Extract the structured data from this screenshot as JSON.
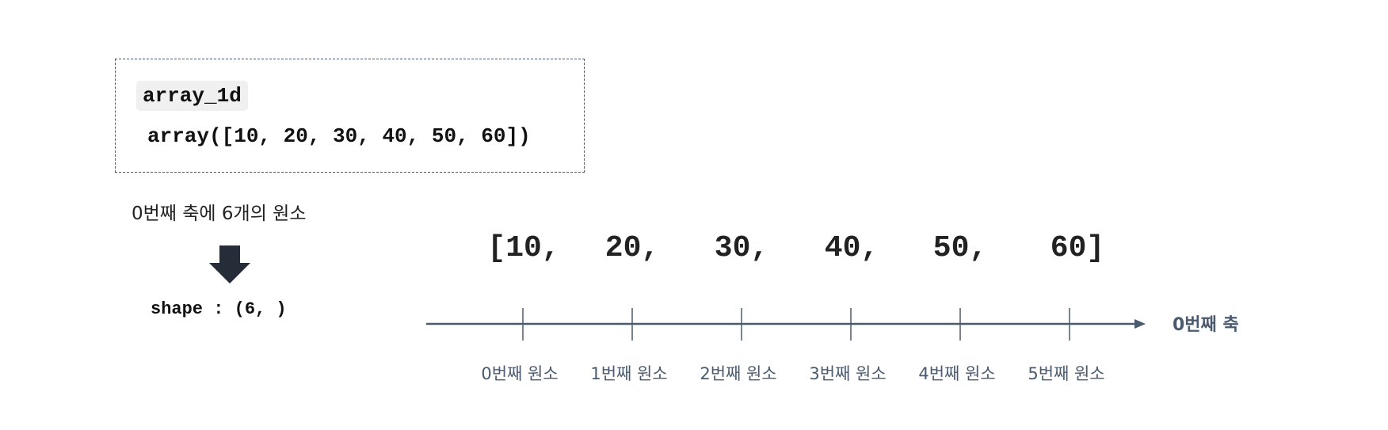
{
  "code_block": {
    "variable": "array_1d",
    "output": "array([10, 20, 30, 40, 50, 60])"
  },
  "caption": "0번째 축에 6개의 원소",
  "shape": "shape : (6, )",
  "array_values": [
    {
      "text": "[10,"
    },
    {
      "text": "20,"
    },
    {
      "text": "30,"
    },
    {
      "text": "40,"
    },
    {
      "text": "50,"
    },
    {
      "text": "60]"
    }
  ],
  "axis": {
    "label": "0번째 축",
    "ticks": [
      {
        "label": "0번째 원소"
      },
      {
        "label": "1번째 원소"
      },
      {
        "label": "2번째 원소"
      },
      {
        "label": "3번째 원소"
      },
      {
        "label": "4번째 원소"
      },
      {
        "label": "5번째 원소"
      }
    ]
  },
  "colors": {
    "axis": "#4b5a6e",
    "arrow": "#262d38"
  }
}
